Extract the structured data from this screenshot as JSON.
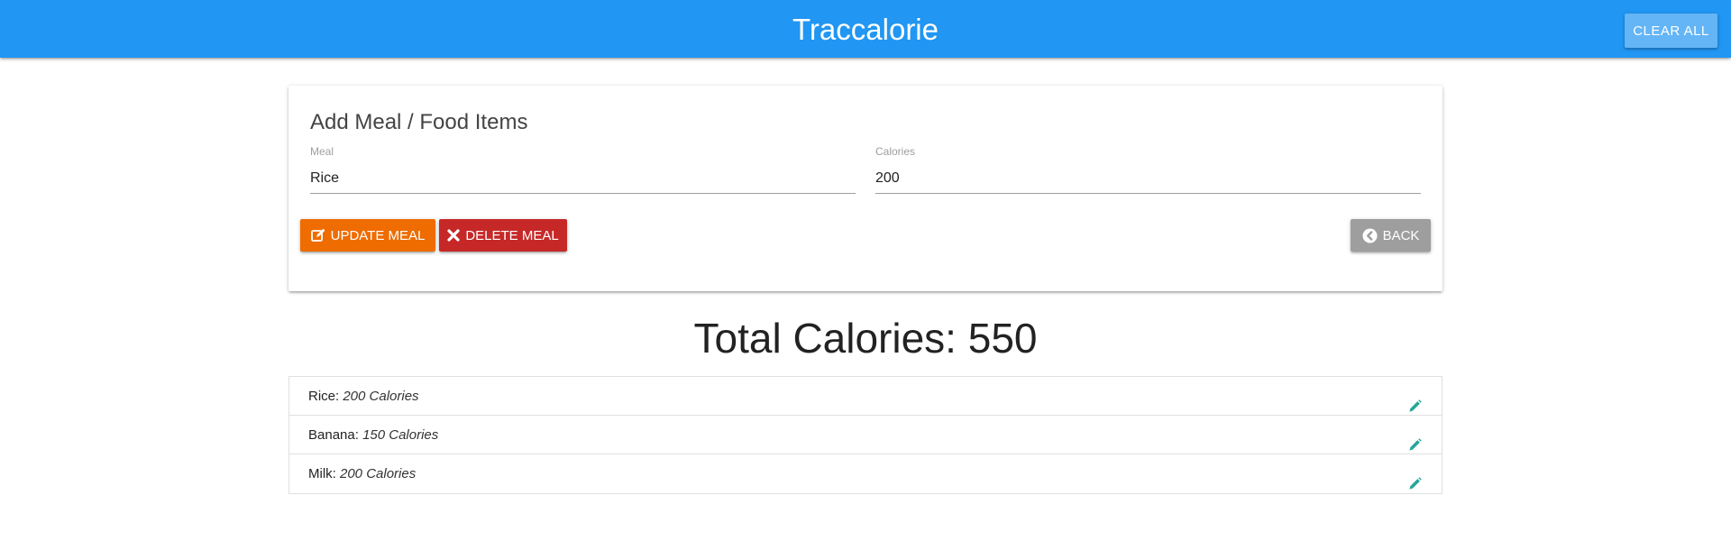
{
  "navbar": {
    "title": "Traccalorie",
    "clear_all_label": "CLEAR ALL",
    "color": "#2196f3"
  },
  "form": {
    "title": "Add Meal / Food Items",
    "meal_label": "Meal",
    "meal_value": "Rice",
    "calories_label": "Calories",
    "calories_value": "200",
    "update_label": "UPDATE MEAL",
    "delete_label": "DELETE MEAL",
    "back_label": "BACK",
    "update_icon": "edit-square-icon",
    "delete_icon": "times-icon",
    "back_icon": "chevron-circle-left-icon"
  },
  "total": {
    "text": "Total Calories: 550"
  },
  "items": [
    {
      "name": "Rice:",
      "calories": "200 Calories",
      "icon": "pencil-icon"
    },
    {
      "name": "Banana:",
      "calories": "150 Calories",
      "icon": "pencil-icon"
    },
    {
      "name": "Milk:",
      "calories": "200 Calories",
      "icon": "pencil-icon"
    }
  ],
  "colors": {
    "update": "#ef6c00",
    "delete": "#c62828",
    "back": "#9e9e9e",
    "edit_icon": "#26a69a"
  }
}
